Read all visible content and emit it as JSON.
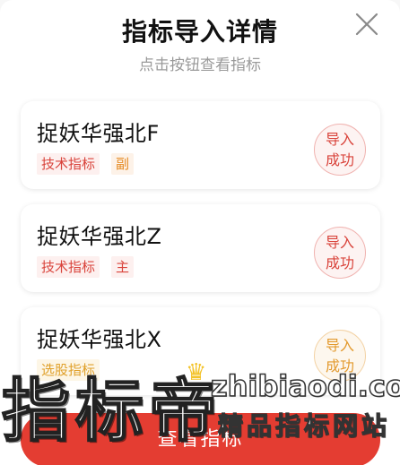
{
  "header": {
    "title": "指标导入详情",
    "subtitle": "点击按钮查看指标",
    "close_icon": "close-icon"
  },
  "items": [
    {
      "name": "捉妖华强北F",
      "type_tag": "技术指标",
      "role_tag": "副",
      "status_line1": "导入",
      "status_line2": "成功"
    },
    {
      "name": "捉妖华强北Z",
      "type_tag": "技术指标",
      "role_tag": "主",
      "status_line1": "导入",
      "status_line2": "成功"
    },
    {
      "name": "捉妖华强北X",
      "type_tag": "选股指标",
      "role_tag": "",
      "status_line1": "导入",
      "status_line2": "成功"
    }
  ],
  "footer": {
    "button_label": "查看指标"
  },
  "watermark": {
    "brand": "指标帝",
    "url": "zhibiaodi.com",
    "slogan": "精品指标网站",
    "crown_icon": "crown-icon"
  },
  "colors": {
    "accent_red": "#e43d32",
    "tag_red": "#d9433b",
    "tag_orange": "#e58a22",
    "tag_yellow": "#e0a02a"
  }
}
